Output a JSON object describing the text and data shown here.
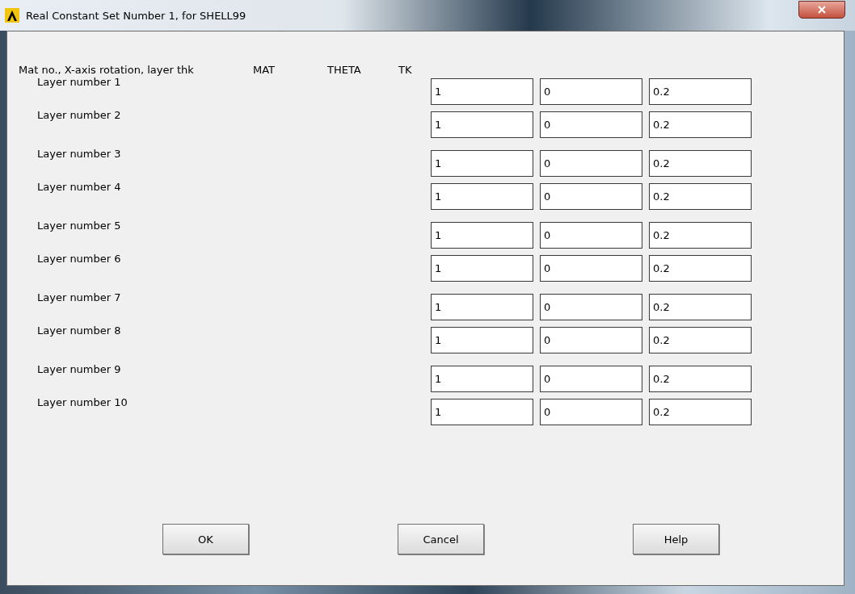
{
  "window": {
    "title": "Real Constant Set Number 1, for SHELL99"
  },
  "header": {
    "label": "Mat no., X-axis rotation, layer thk",
    "columns": [
      "MAT",
      "THETA",
      "TK"
    ]
  },
  "layers": [
    {
      "label": "Layer number 1",
      "values": [
        "1",
        "0",
        "0.2"
      ]
    },
    {
      "label": "Layer number 2",
      "values": [
        "1",
        "0",
        "0.2"
      ]
    },
    {
      "label": "Layer number 3",
      "values": [
        "1",
        "0",
        "0.2"
      ]
    },
    {
      "label": "Layer number 4",
      "values": [
        "1",
        "0",
        "0.2"
      ]
    },
    {
      "label": "Layer number 5",
      "values": [
        "1",
        "0",
        "0.2"
      ]
    },
    {
      "label": "Layer number 6",
      "values": [
        "1",
        "0",
        "0.2"
      ]
    },
    {
      "label": "Layer number 7",
      "values": [
        "1",
        "0",
        "0.2"
      ]
    },
    {
      "label": "Layer number 8",
      "values": [
        "1",
        "0",
        "0.2"
      ]
    },
    {
      "label": "Layer number 9",
      "values": [
        "1",
        "0",
        "0.2"
      ]
    },
    {
      "label": "Layer number 10",
      "values": [
        "1",
        "0",
        "0.2"
      ]
    }
  ],
  "buttons": [
    "OK",
    "Cancel",
    "Help"
  ]
}
